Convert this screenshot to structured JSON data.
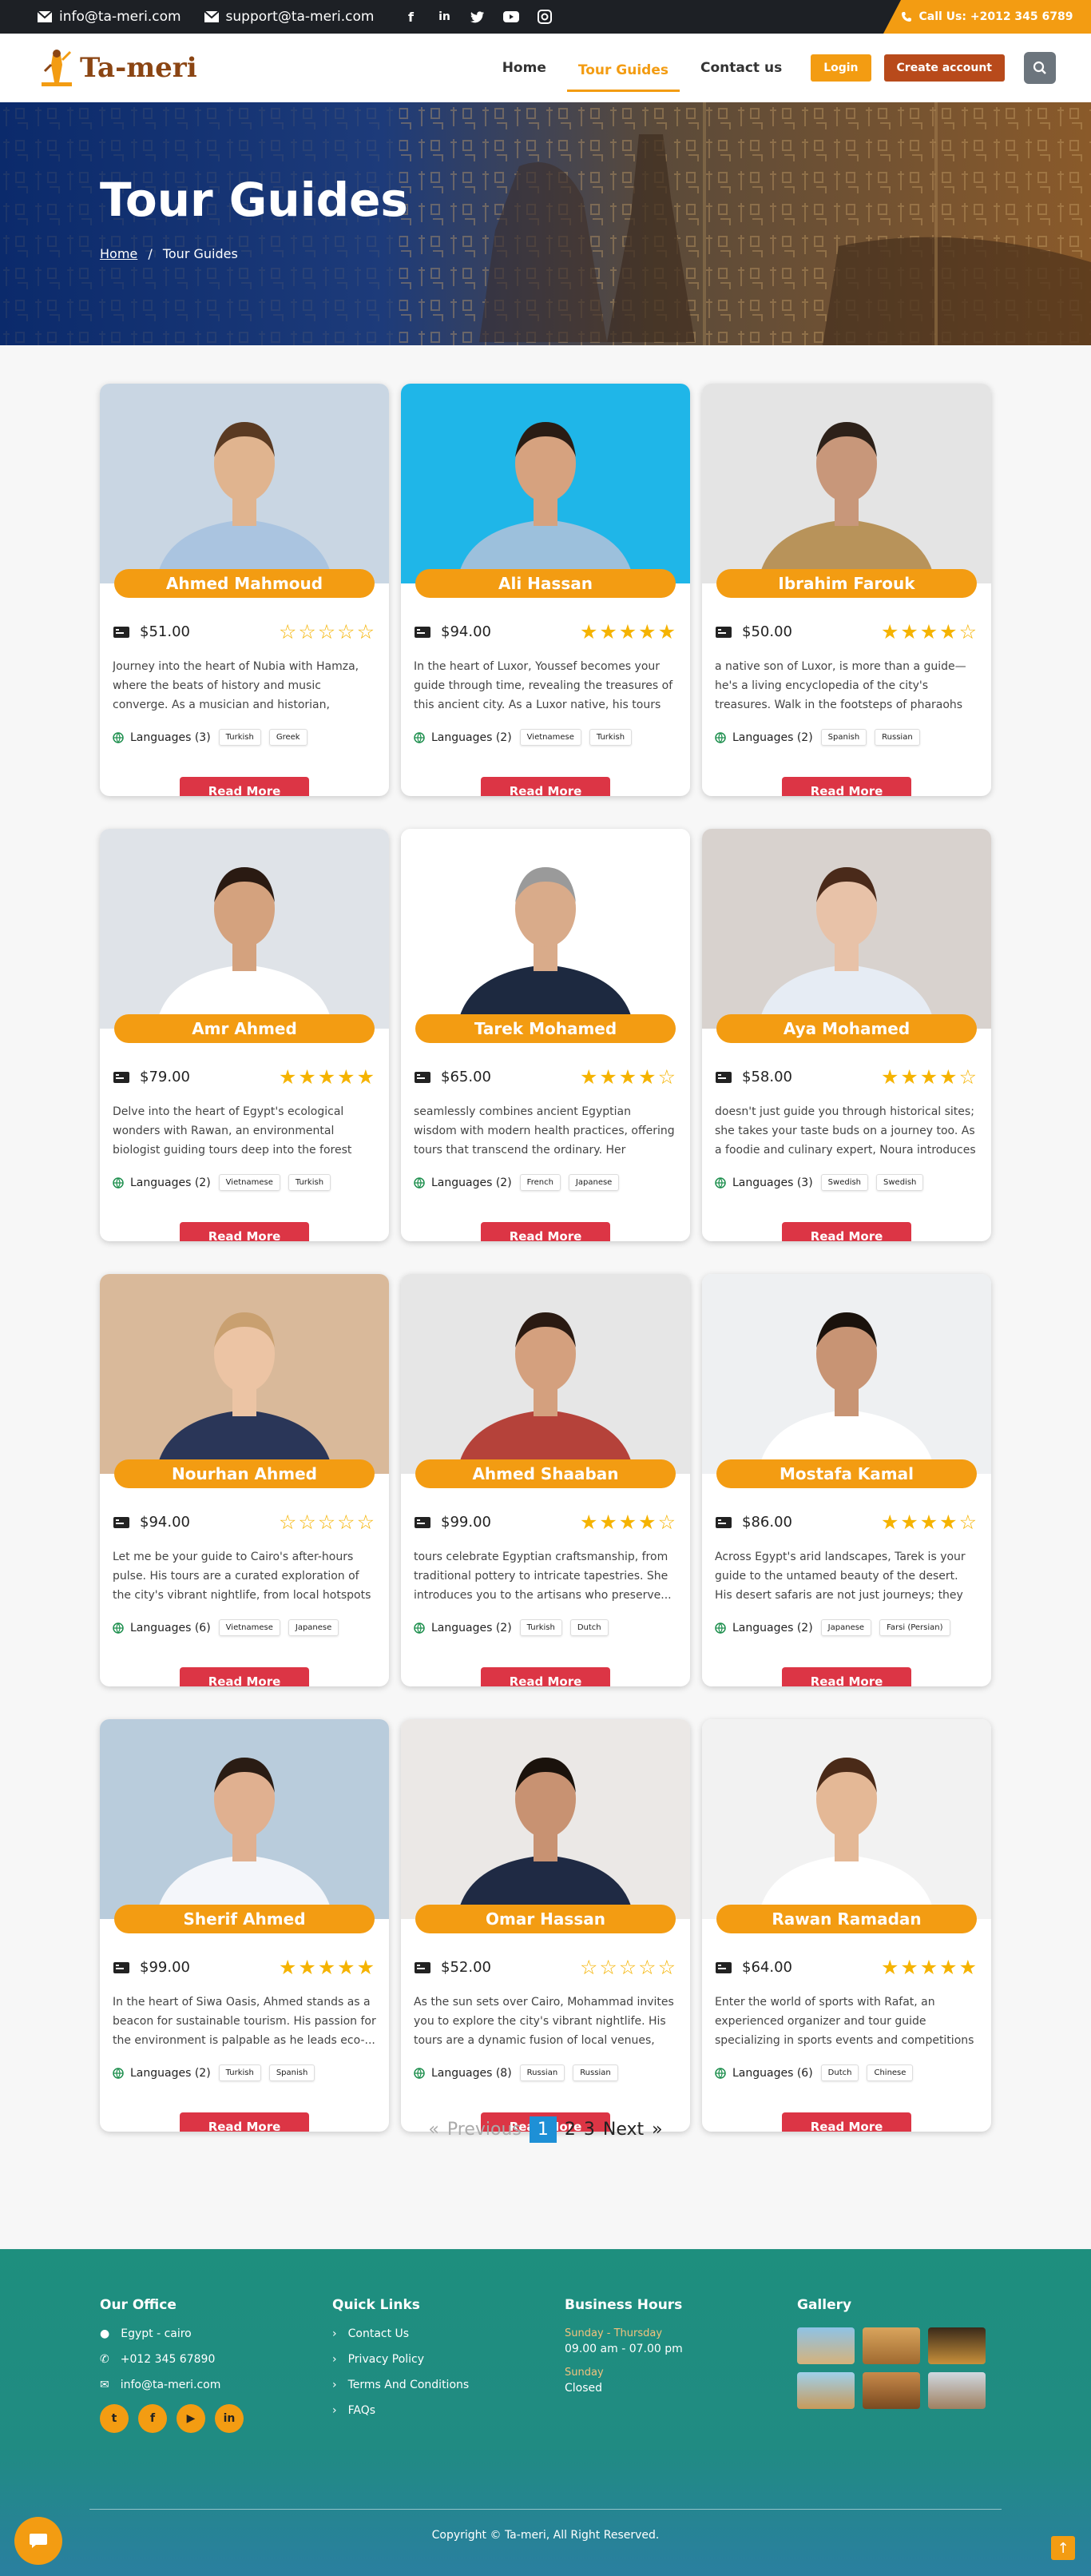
{
  "topbar": {
    "email1": "info@ta-meri.com",
    "email2": "support@ta-meri.com",
    "socials": [
      "f",
      "in",
      "t",
      "yt",
      "ig"
    ],
    "call_label": "Call Us:",
    "call_number": "+2012 345 6789"
  },
  "nav": {
    "logo": "Ta-meri",
    "home": "Home",
    "tour_guides": "Tour Guides",
    "contact": "Contact us",
    "login": "Login",
    "create": "Create account"
  },
  "hero": {
    "title": "Tour Guides",
    "crumb_home": "Home",
    "crumb_sep": "/",
    "crumb_current": "Tour Guides"
  },
  "guides": [
    {
      "name": "Ahmed Mahmoud",
      "price": "$51.00",
      "rating": 0,
      "desc": "Journey into the heart of Nubia with Hamza, where the beats of history and music converge. As a musician and historian, Hamza's tours are ...",
      "langs": "Languages (3)",
      "chips": [
        "Turkish",
        "Greek"
      ],
      "bg": "#c9d6e3",
      "skin": "#e0b48f",
      "shirt": "#aac4e0",
      "hair": "#5a3a22"
    },
    {
      "name": "Ali Hassan",
      "price": "$94.00",
      "rating": 5,
      "desc": "In the heart of Luxor, Youssef becomes your guide through time, revealing the treasures of this ancient city. As a Luxor native, his tours are...",
      "langs": "Languages (2)",
      "chips": [
        "Vietnamese",
        "Turkish"
      ],
      "bg": "#1fb6e8",
      "skin": "#d6a27f",
      "shirt": "#9cc0dc",
      "hair": "#2a1c14"
    },
    {
      "name": "Ibrahim Farouk",
      "price": "$50.00",
      "rating": 4,
      "desc": "a native son of Luxor, is more than a guide—he's a living encyclopedia of the city's treasures. Walk in the footsteps of pharaohs as Youssef unfolds...",
      "langs": "Languages (2)",
      "chips": [
        "Spanish",
        "Russian"
      ],
      "bg": "#e4e4e4",
      "skin": "#c8977a",
      "shirt": "#b8935a",
      "hair": "#2d2119"
    },
    {
      "name": "Amr Ahmed",
      "price": "$79.00",
      "rating": 5,
      "desc": "Delve into the heart of Egypt's ecological wonders with Rawan, an environmental biologist guiding tours deep into the forest and desert ...",
      "langs": "Languages (2)",
      "chips": [
        "Vietnamese",
        "Turkish"
      ],
      "bg": "#dfe3e8",
      "skin": "#d4a27e",
      "shirt": "#ffffff",
      "hair": "#2a1a12"
    },
    {
      "name": "Tarek Mohamed",
      "price": "$65.00",
      "rating": 4,
      "desc": "seamlessly combines ancient Egyptian wisdom with modern health practices, offering tours that transcend the ordinary. Her approach goe...",
      "langs": "Languages (2)",
      "chips": [
        "French",
        "Japanese"
      ],
      "bg": "#ffffff",
      "skin": "#d9ab8a",
      "shirt": "#1d2940",
      "hair": "#9a9a9a"
    },
    {
      "name": "Aya Mohamed",
      "price": "$58.00",
      "rating": 4,
      "desc": "doesn't just guide you through historical sites; she takes your taste buds on a journey too. As a foodie and culinary expert, Noura introduces yo...",
      "langs": "Languages (3)",
      "chips": [
        "Swedish",
        "Swedish"
      ],
      "bg": "#d8d2ce",
      "skin": "#e8c2a8",
      "shirt": "#e6ecf4",
      "hair": "#4a2a1a"
    },
    {
      "name": "Nourhan Ahmed",
      "price": "$94.00",
      "rating": 0,
      "desc": "Let me be your guide to Cairo's after-hours pulse. His tours are a curated exploration of the city's vibrant nightlife, from local hotspots to li...",
      "langs": "Languages (6)",
      "chips": [
        "Vietnamese",
        "Japanese"
      ],
      "bg": "#d9b99a",
      "skin": "#ecc4a4",
      "shirt": "#2a3658",
      "hair": "#c9a070"
    },
    {
      "name": "Ahmed Shaaban",
      "price": "$99.00",
      "rating": 4,
      "desc": "tours celebrate Egyptian craftsmanship, from traditional pottery to intricate tapestries. She introduces you to the artisans who preserve...",
      "langs": "Languages (2)",
      "chips": [
        "Turkish",
        "Dutch"
      ],
      "bg": "#e6e6e6",
      "skin": "#d4a07e",
      "shirt": "#b5423a",
      "hair": "#2a1a12"
    },
    {
      "name": "Mostafa Kamal",
      "price": "$86.00",
      "rating": 4,
      "desc": "Across Egypt's arid landscapes, Tarek is your guide to the untamed beauty of the desert. His desert safaris are not just journeys; they are...",
      "langs": "Languages (2)",
      "chips": [
        "Japanese",
        "Farsi (Persian)"
      ],
      "bg": "#eef0f2",
      "skin": "#c89474",
      "shirt": "#ffffff",
      "hair": "#1a120c"
    },
    {
      "name": "Sherif Ahmed",
      "price": "$99.00",
      "rating": 5,
      "desc": "In the heart of Siwa Oasis, Ahmed stands as a beacon for sustainable tourism. His passion for the environment is palpable as he leads eco-...",
      "langs": "Languages (2)",
      "chips": [
        "Turkish",
        "Spanish"
      ],
      "bg": "#b9ccdc",
      "skin": "#e0b090",
      "shirt": "#f4f6fa",
      "hair": "#2a1c14"
    },
    {
      "name": "Omar Hassan",
      "price": "$52.00",
      "rating": 0,
      "desc": "As the sun sets over Cairo, Mohammad invites you to explore the city's vibrant nightlife. His tours are a dynamic fusion of local venues, live...",
      "langs": "Languages (8)",
      "chips": [
        "Russian",
        "Russian"
      ],
      "bg": "#ebe8e6",
      "skin": "#c89272",
      "shirt": "#1f2a44",
      "hair": "#1a120c"
    },
    {
      "name": "Rawan Ramadan",
      "price": "$64.00",
      "rating": 5,
      "desc": "Enter the world of sports with Rafat, an experienced organizer and tour guide specializing in sports events and competitions i...",
      "langs": "Languages (6)",
      "chips": [
        "Dutch",
        "Chinese"
      ],
      "bg": "#f2f2f2",
      "skin": "#e4b896",
      "shirt": "#ffffff",
      "hair": "#4a2a18"
    }
  ],
  "read_more": "Read More",
  "pagination": {
    "prev": "Previous",
    "p1": "1",
    "p2": "2",
    "p3": "3",
    "next": "Next",
    "laquo": "«",
    "raquo": "»"
  },
  "footer": {
    "office_title": "Our Office",
    "office_city": "Egypt - cairo",
    "office_phone": "+012 345 67890",
    "office_email": "info@ta-meri.com",
    "links_title": "Quick Links",
    "links": [
      "Contact Us",
      "Privacy Policy",
      "Terms And Conditions",
      "FAQs"
    ],
    "hours_title": "Business Hours",
    "hours_day1": "Sunday - Thursday",
    "hours_time1": "09.00 am - 07.00 pm",
    "hours_day2": "Sunday",
    "hours_time2": "Closed",
    "gallery_title": "Gallery",
    "copyright": "Copyright © Ta-meri, All Right Reserved."
  }
}
